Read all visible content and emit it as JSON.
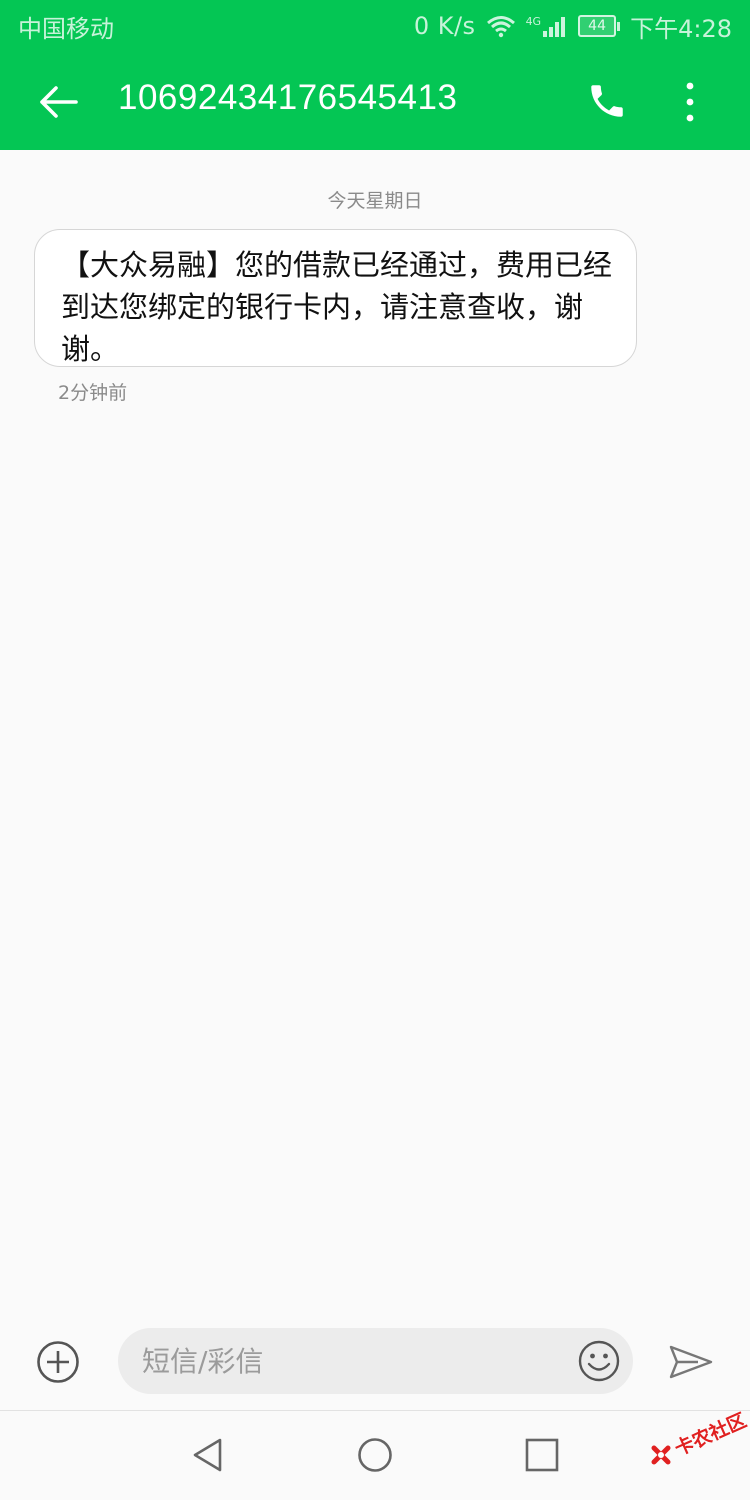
{
  "status_bar": {
    "carrier": "中国移动",
    "net_speed": "0 K/s",
    "network_type": "4G",
    "battery_level": "44",
    "time": "下午4:28",
    "icons": [
      "wifi-icon",
      "signal-icon",
      "battery-icon"
    ]
  },
  "header": {
    "title": "10692434176545413",
    "icons": [
      "back-arrow-icon",
      "phone-icon",
      "more-vert-icon"
    ],
    "bg_color": "#04c654"
  },
  "conversation": {
    "date_separator": "今天星期日",
    "messages": [
      {
        "text": "【大众易融】您的借款已经通过，费用已经到达您绑定的银行卡内，请注意查收，谢谢。",
        "time": "2分钟前"
      }
    ]
  },
  "composer": {
    "placeholder": "短信/彩信",
    "icons": [
      "add-circle-icon",
      "emoji-icon",
      "send-icon"
    ]
  },
  "nav_bar": {
    "icons": [
      "nav-back-icon",
      "nav-home-icon",
      "nav-recents-icon"
    ]
  },
  "watermark": {
    "text": "卡农社区",
    "color": "#e02020"
  }
}
